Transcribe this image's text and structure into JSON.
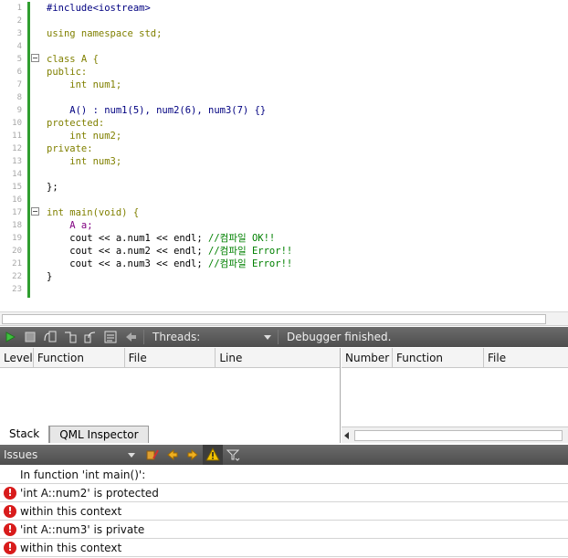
{
  "editor": {
    "line_numbers": [
      "1",
      "2",
      "3",
      "4",
      "5",
      "6",
      "7",
      "8",
      "9",
      "10",
      "11",
      "12",
      "13",
      "14",
      "15",
      "16",
      "17",
      "18",
      "19",
      "20",
      "21",
      "22",
      "23"
    ],
    "lines": [
      "#include<iostream>",
      "",
      "using namespace std;",
      "",
      "class A {",
      "public:",
      "    int num1;",
      "",
      "    A() : num1(5), num2(6), num3(7) {}",
      "protected:",
      "    int num2;",
      "private:",
      "    int num3;",
      "",
      "};",
      "",
      "int main(void) {",
      "    A a;",
      "    cout << a.num1 << endl; //컴파일 OK!!",
      "    cout << a.num2 << endl; //컴파일 Error!!",
      "    cout << a.num3 << endl; //컴파일 Error!!",
      "}",
      ""
    ]
  },
  "debugger": {
    "threads_label": "Threads:",
    "status": "Debugger finished.",
    "icons": [
      "continue-icon",
      "stop-icon",
      "step-over-icon",
      "step-into-icon",
      "step-out-icon",
      "operate-by-instruction-icon",
      "reverse-icon"
    ]
  },
  "stack": {
    "columns": [
      "Level",
      "Function",
      "File",
      "Line"
    ],
    "tabs": [
      "Stack",
      "QML Inspector"
    ]
  },
  "breakpoints": {
    "columns": [
      "Number",
      "Function",
      "File"
    ]
  },
  "issues": {
    "title": "Issues",
    "items": [
      {
        "type": "info",
        "text": "In function 'int main()':"
      },
      {
        "type": "error",
        "text": "'int A::num2' is protected"
      },
      {
        "type": "error",
        "text": "within this context"
      },
      {
        "type": "error",
        "text": "'int A::num3' is private"
      },
      {
        "type": "error",
        "text": "within this context"
      }
    ]
  },
  "colors": {
    "gutter_bar": "#2f9e2f",
    "toolbar_bg": "#5a5a5a",
    "error": "#d81b1b",
    "keyword": "#808000",
    "comment": "#008000"
  }
}
